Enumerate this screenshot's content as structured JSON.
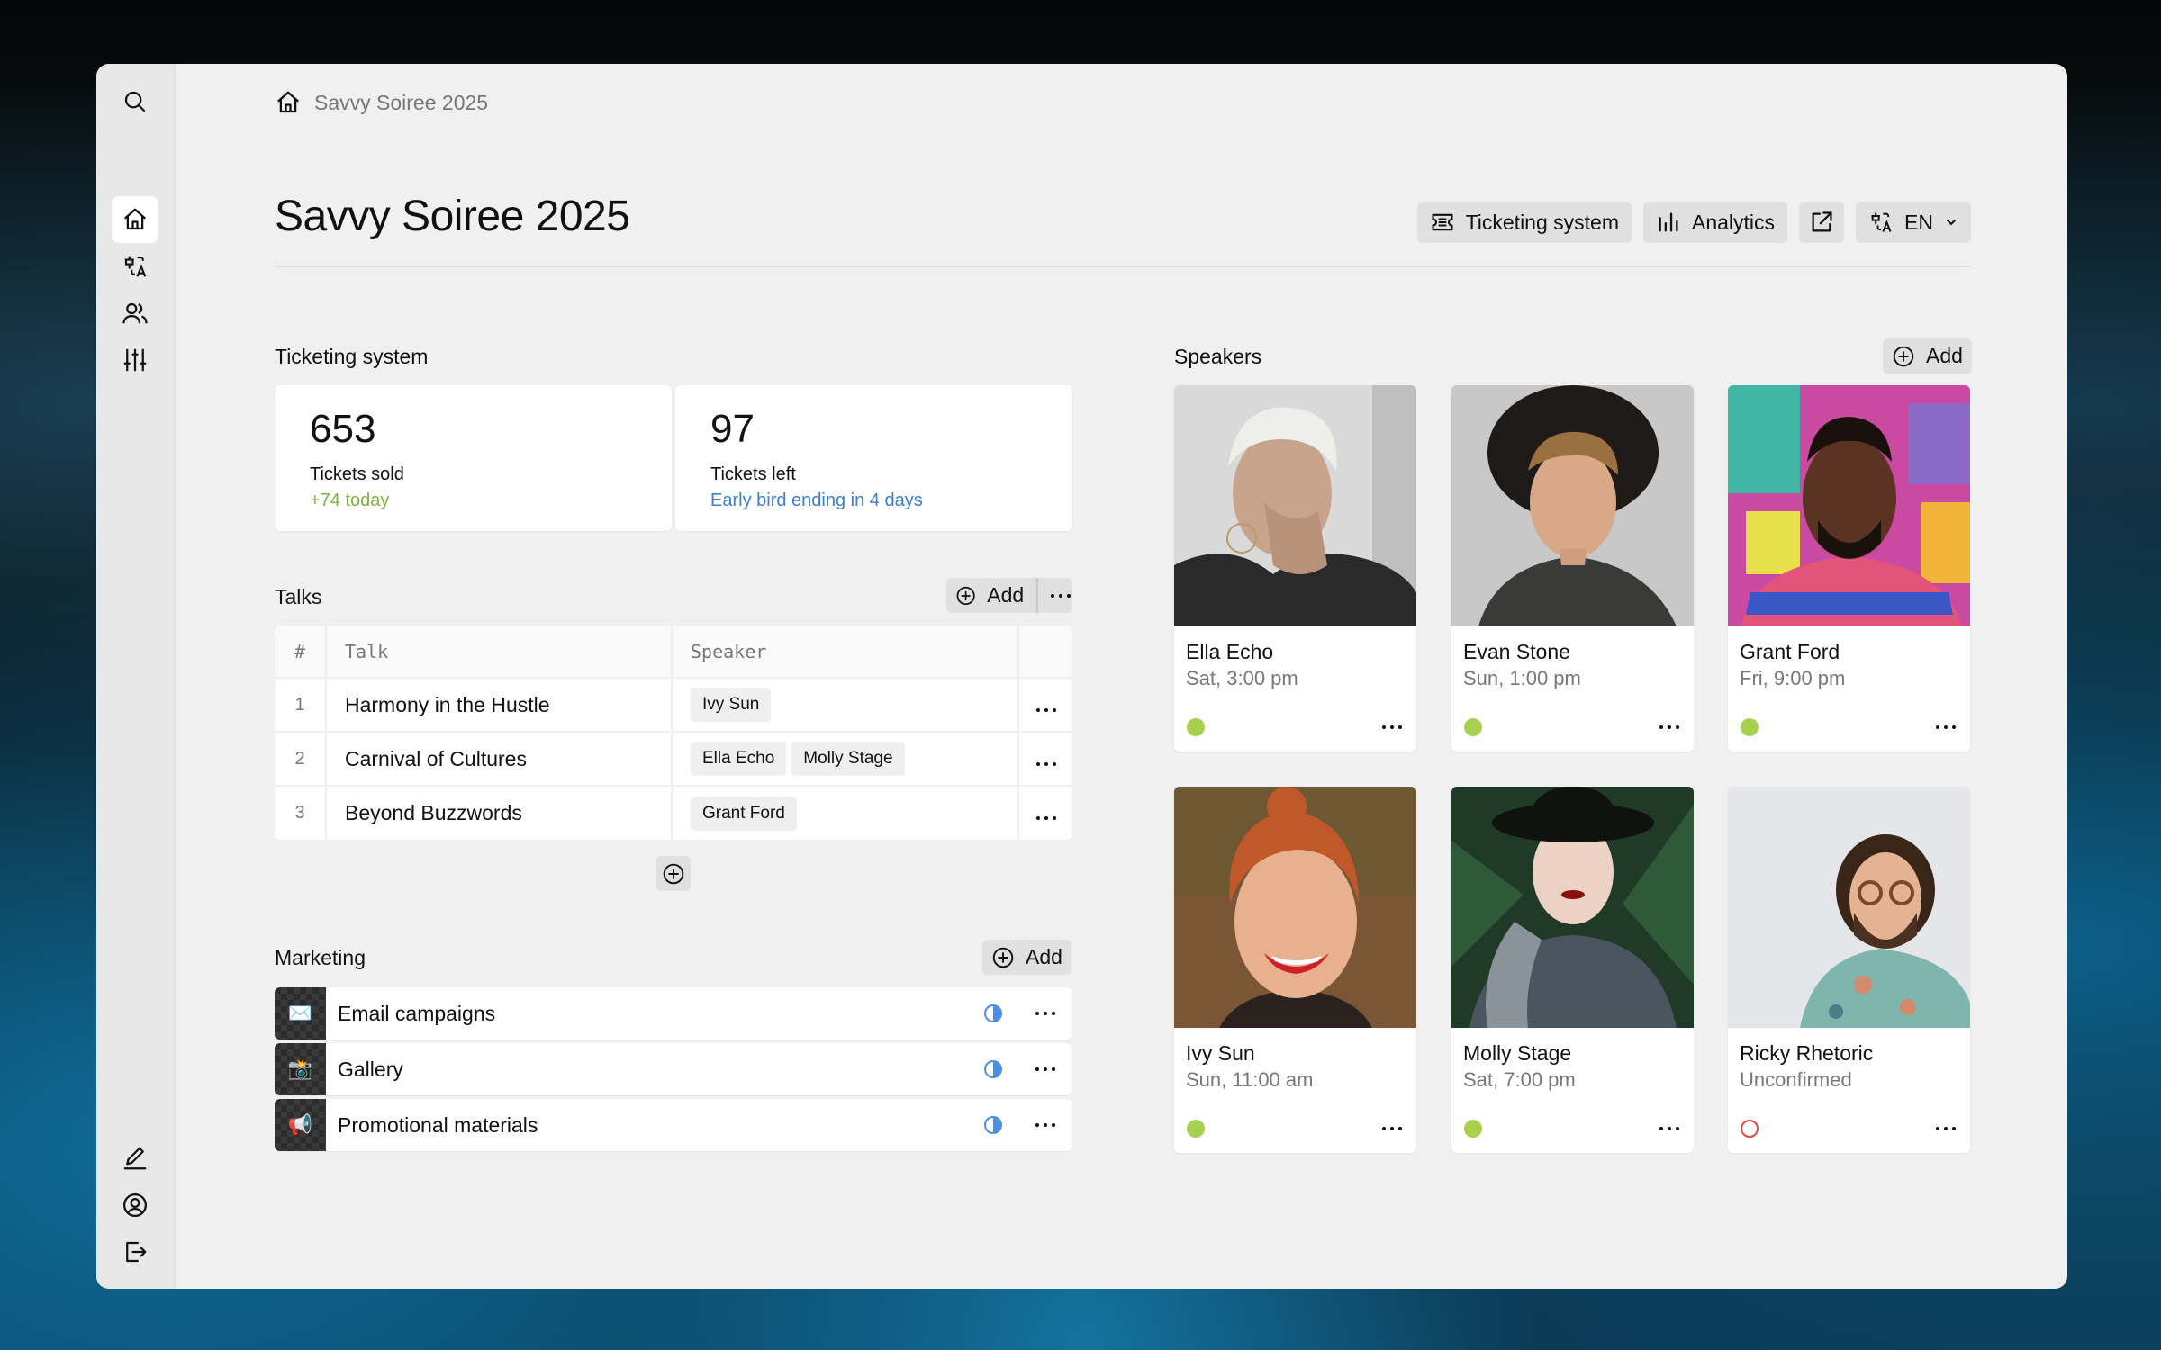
{
  "colors": {
    "accent_green": "#7cb342",
    "accent_blue": "#3a7fd0",
    "status_confirmed": "#a8d14f",
    "status_unconfirmed": "#e5484d",
    "progress_blue": "#4a90e2"
  },
  "sidebar": {
    "top": [
      {
        "icon": "search-icon",
        "label": "Search"
      }
    ],
    "nav": [
      {
        "icon": "home-icon",
        "label": "Home",
        "active": true
      },
      {
        "icon": "translate-icon",
        "label": "Translations",
        "active": false
      },
      {
        "icon": "users-icon",
        "label": "People",
        "active": false
      },
      {
        "icon": "sliders-icon",
        "label": "Settings",
        "active": false
      }
    ],
    "bottom": [
      {
        "icon": "pencil-icon",
        "label": "Edit"
      },
      {
        "icon": "account-icon",
        "label": "Account"
      },
      {
        "icon": "logout-icon",
        "label": "Log out"
      }
    ]
  },
  "breadcrumb": {
    "icon": "home-icon",
    "label": "Savvy Soiree 2025"
  },
  "header": {
    "title": "Savvy Soiree 2025",
    "actions": {
      "ticketing": "Ticketing system",
      "analytics": "Analytics",
      "language": "EN"
    }
  },
  "ticketing": {
    "label": "Ticketing system",
    "cards": [
      {
        "value": "653",
        "label": "Tickets sold",
        "sub": "+74 today",
        "sub_color": "#7cb342"
      },
      {
        "value": "97",
        "label": "Tickets left",
        "sub": "Early bird ending in 4 days",
        "sub_color": "#3a7fd0"
      }
    ]
  },
  "talks": {
    "label": "Talks",
    "add_label": "Add",
    "columns": [
      "#",
      "Talk",
      "Speaker"
    ],
    "rows": [
      {
        "num": "1",
        "talk": "Harmony in the Hustle",
        "speakers": [
          "Ivy Sun"
        ]
      },
      {
        "num": "2",
        "talk": "Carnival of Cultures",
        "speakers": [
          "Ella Echo",
          "Molly Stage"
        ]
      },
      {
        "num": "3",
        "talk": "Beyond Buzzwords",
        "speakers": [
          "Grant Ford"
        ]
      }
    ]
  },
  "marketing": {
    "label": "Marketing",
    "add_label": "Add",
    "items": [
      {
        "label": "Email campaigns",
        "thumb": "✉️",
        "status": "half-circle-icon"
      },
      {
        "label": "Gallery",
        "thumb": "📸",
        "status": "half-circle-icon"
      },
      {
        "label": "Promotional materials",
        "thumb": "📢",
        "status": "half-circle-icon"
      }
    ]
  },
  "speakers": {
    "label": "Speakers",
    "add_label": "Add",
    "items": [
      {
        "name": "Ella Echo",
        "time": "Sat, 3:00 pm",
        "status": "confirmed"
      },
      {
        "name": "Evan Stone",
        "time": "Sun, 1:00 pm",
        "status": "confirmed"
      },
      {
        "name": "Grant Ford",
        "time": "Fri, 9:00 pm",
        "status": "confirmed"
      },
      {
        "name": "Ivy Sun",
        "time": "Sun, 11:00 am",
        "status": "confirmed"
      },
      {
        "name": "Molly Stage",
        "time": "Sat, 7:00 pm",
        "status": "confirmed"
      },
      {
        "name": "Ricky Rhetoric",
        "time": "Unconfirmed",
        "status": "unconfirmed"
      }
    ]
  }
}
